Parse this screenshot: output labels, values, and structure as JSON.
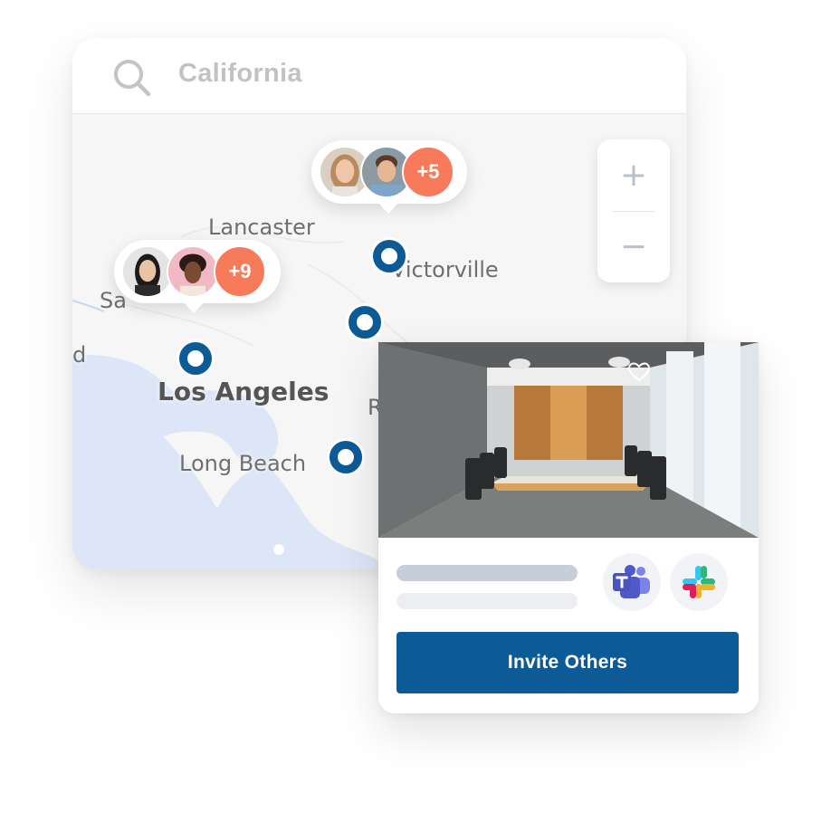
{
  "search": {
    "query": "California",
    "icon": "search-icon"
  },
  "map": {
    "cities": {
      "lancaster": "Lancaster",
      "victorville": "Victorville",
      "santa_clarita_partial": "Sa",
      "oxnard_partial": "d",
      "los_angeles": "Los Angeles",
      "long_beach": "Long Beach",
      "riverside_partial": "R"
    },
    "zoom": {
      "in_label": "+",
      "out_label": "−"
    },
    "colors": {
      "land": "#f6f6f6",
      "water": "#dce6f7",
      "pin": "#0c5a96",
      "count_badge": "#f77a5a"
    }
  },
  "clusters": [
    {
      "count_label": "+5"
    },
    {
      "count_label": "+9"
    }
  ],
  "room_card": {
    "integrations": [
      "microsoft-teams-icon",
      "slack-icon"
    ],
    "invite_label": "Invite Others"
  }
}
